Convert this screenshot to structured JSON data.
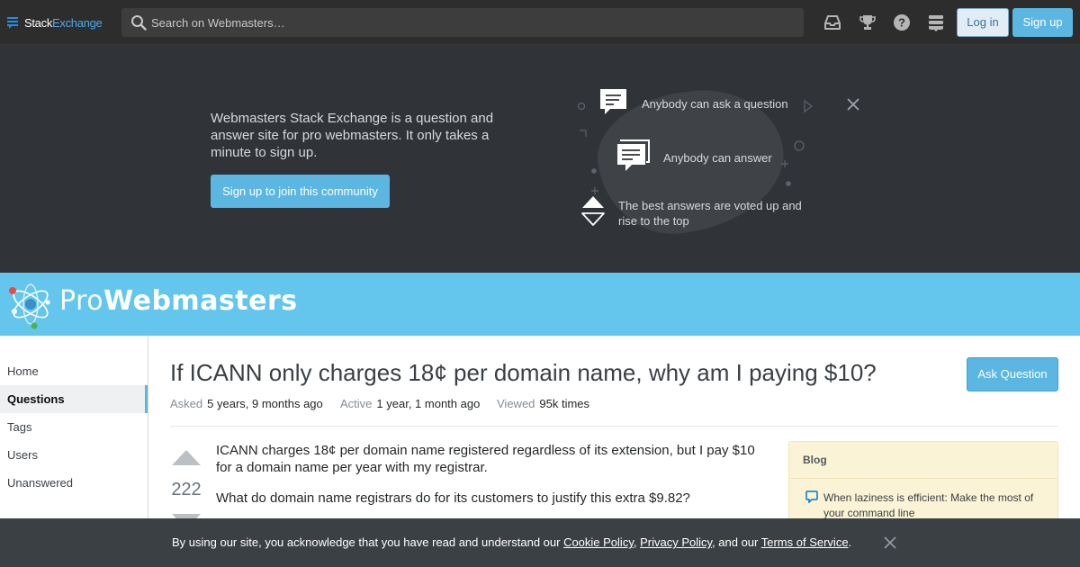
{
  "topbar": {
    "brand_a": "Stack",
    "brand_b": "Exchange",
    "search_placeholder": "Search on Webmasters…",
    "login_label": "Log in",
    "signup_label": "Sign up",
    "icons": [
      "inbox-icon",
      "trophy-icon",
      "help-icon",
      "site-switcher-icon"
    ]
  },
  "hero": {
    "text": "Webmasters Stack Exchange is a question and answer site for pro webmasters. It only takes a minute to sign up.",
    "join_label": "Sign up to join this community",
    "features": [
      {
        "text": "Anybody can ask a question",
        "icon": "ask-question-icon"
      },
      {
        "text": "Anybody can answer",
        "icon": "answer-icon"
      },
      {
        "text": "The best answers are voted up and rise to the top",
        "icon": "vote-icon"
      }
    ]
  },
  "site": {
    "name_a": "Pro",
    "name_b": "Webmasters"
  },
  "nav": {
    "items": [
      {
        "label": "Home",
        "active": false
      },
      {
        "label": "Questions",
        "active": true
      },
      {
        "label": "Tags",
        "active": false
      },
      {
        "label": "Users",
        "active": false
      },
      {
        "label": "Unanswered",
        "active": false
      }
    ]
  },
  "question": {
    "title": "If ICANN only charges 18¢ per domain name, why am I paying $10?",
    "ask_label": "Ask Question",
    "asked_label": "Asked",
    "asked_value": "5 years, 9 months ago",
    "active_label": "Active",
    "active_value": "1 year, 1 month ago",
    "viewed_label": "Viewed",
    "viewed_value": "95k times",
    "votes": "222",
    "body": [
      "ICANN charges 18¢ per domain name registered regardless of its extension, but I pay $10 for a domain name per year with my registrar.",
      "What do domain name registrars do for its customers to justify this extra $9.82?"
    ]
  },
  "blog": {
    "heading": "Blog",
    "item": "When laziness is efficient: Make the most of your command line"
  },
  "cookie": {
    "prefix": "By using our site, you acknowledge that you have read and understand our ",
    "cookie_policy": "Cookie Policy",
    "sep1": ", ",
    "privacy_policy": "Privacy Policy",
    "sep2": ", and our ",
    "terms": "Terms of Service",
    "suffix": "."
  },
  "colors": {
    "topbar_bg": "#2d2d2d",
    "hero_bg": "#303338",
    "site_header_bg": "#65c6ed",
    "accent_blue": "#5bb6e1",
    "cookie_bg": "#3b4045",
    "blog_bg": "#fbf3d5"
  }
}
